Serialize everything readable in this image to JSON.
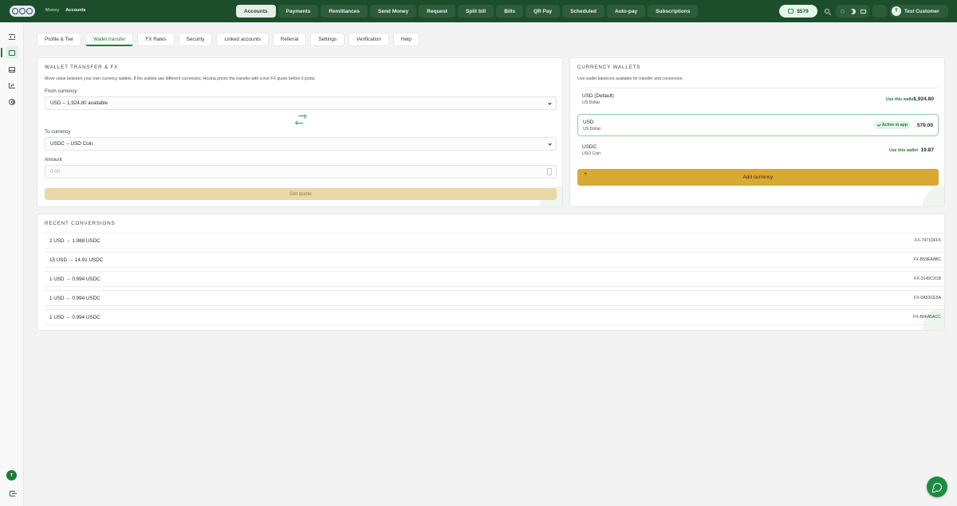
{
  "header": {
    "breadcrumb": [
      "Money",
      "Accounts"
    ],
    "nav": [
      {
        "label": "Accounts",
        "active": true
      },
      {
        "label": "Payments"
      },
      {
        "label": "Remittances"
      },
      {
        "label": "Send Money"
      },
      {
        "label": "Request"
      },
      {
        "label": "Split bill"
      },
      {
        "label": "Bills"
      },
      {
        "label": "QR Pay"
      },
      {
        "label": "Scheduled"
      },
      {
        "label": "Auto-pay"
      },
      {
        "label": "Subscriptions"
      }
    ],
    "balance": "$579",
    "user": {
      "initial": "T",
      "name": "Test Customer"
    }
  },
  "sidebar": {
    "items": [
      {
        "icon": "bank-icon"
      },
      {
        "icon": "wallet-icon",
        "active": true
      },
      {
        "icon": "inbox-icon"
      },
      {
        "icon": "chart-icon"
      },
      {
        "icon": "user-circle-icon"
      }
    ],
    "avatar_initial": "T"
  },
  "subtabs": [
    {
      "label": "Profile & Tier"
    },
    {
      "label": "Wallet transfer",
      "active": true
    },
    {
      "label": "FX Rates"
    },
    {
      "label": "Security"
    },
    {
      "label": "Linked accounts"
    },
    {
      "label": "Referral"
    },
    {
      "label": "Settings"
    },
    {
      "label": "Verification"
    },
    {
      "label": "Help"
    }
  ],
  "transfer": {
    "title": "WALLET TRANSFER & FX",
    "description": "Move value between your own currency wallets. If the wallets use different currencies, Hozina prices the transfer with a live FX quote before it posts.",
    "from_label": "From currency",
    "from_value": "USD -- 1,924.80 available",
    "to_label": "To currency",
    "to_value": "USDC -- USD Coin",
    "amount_label": "Amount",
    "amount_placeholder": "0.00",
    "quote_button": "Get quote"
  },
  "wallets": {
    "title": "CURRENCY WALLETS",
    "description": "Live wallet balances available for transfer and conversion.",
    "items": [
      {
        "code": "USD (Default)",
        "name": "US Dollar",
        "action": "Use this wallet",
        "amount": "1,924.80"
      },
      {
        "code": "USD",
        "name": "US Dollar",
        "badge": "Active in app",
        "amount": "579.00",
        "active": true
      },
      {
        "code": "USDC",
        "name": "USD Coin",
        "action": "Use this wallet",
        "amount": "19.87"
      }
    ],
    "add_button": "Add currency",
    "add_symbol": "+"
  },
  "conversions": {
    "title": "RECENT CONVERSIONS",
    "rows": [
      {
        "text": "2 USD → 1.988 USDC",
        "id": "FX-7471DFF5"
      },
      {
        "text": "15 USD → 14.91 USDC",
        "id": "FX-B59EA8BC"
      },
      {
        "text": "1 USD → 0.994 USDC",
        "id": "FX-3145C2CB"
      },
      {
        "text": "1 USD → 0.994 USDC",
        "id": "FX-0A53CE5A"
      },
      {
        "text": "1 USD → 0.994 USDC",
        "id": "FX-B06A5ACC"
      }
    ]
  },
  "colors": {
    "brand_dark": "#1c4e2c",
    "accent_green": "#1e7b3d",
    "add_currency_gold": "#d9a935",
    "quote_button_disabled": "#e9d8a8"
  }
}
